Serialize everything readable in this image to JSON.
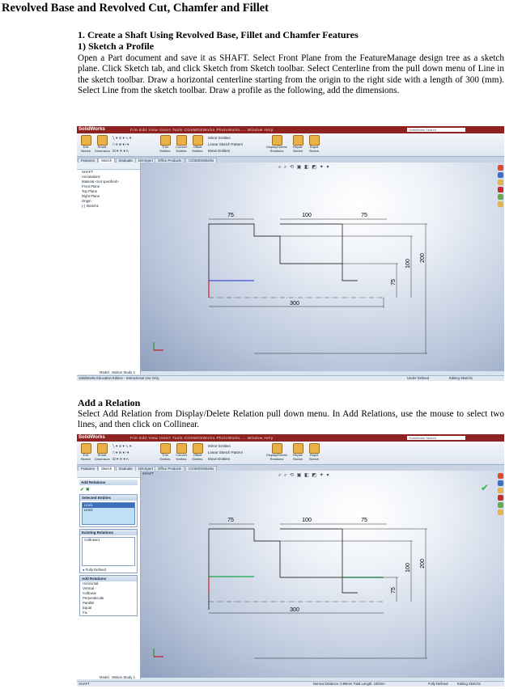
{
  "document": {
    "title": "Revolved Base and Revolved Cut, Chamfer and Fillet",
    "heading1": "1. Create a Shaft Using Revolved Base, Fillet and Chamfer Features",
    "heading2": "1) Sketch a Profile",
    "paragraph1": "Open a Part document and save it as SHAFT. Select Front Plane from the FeatureManage design tree as a sketch plane. Click Sketch tab, and click Sketch from Sketch toolbar. Select Centerline from the pull down menu of Line in the sketch toolbar. Draw a horizontal centerline starting from the origin to the right side with a length of 300 (mm). Select Line from the sketch toolbar. Draw a profile as the following, add the dimensions.",
    "heading3": "Add a Relation",
    "paragraph2": "Select Add Relation from Display/Delete Relation pull down menu. In Add Relations, use the mouse to select two lines, and then click on Collinear."
  },
  "app": {
    "logo": "SolidWorks",
    "menu": "File   Edit   View   Insert   Tools   COSMOSWorks   PhotoWorks   ...   Window   Help",
    "search_placeholder": "SolidWorks Search",
    "ribbon": {
      "exit_sketch": "Exit Sketch",
      "smart_dimension": "Smart Dimension",
      "trim_entities": "Trim Entities",
      "convert_entities": "Convert Entities",
      "offset_entities": "Offset Entities",
      "mirror_entities": "Mirror Entities",
      "linear_pattern": "Linear Sketch Pattern",
      "move_entities": "Move Entities",
      "display_delete_relations": "Display/Delete Relations",
      "repair_sketch": "Repair Sketch",
      "rapid_sketch": "Rapid Sketch"
    },
    "tabs": [
      "Features",
      "Sketch",
      "Evaluate",
      "DimXpert",
      "Office Products",
      "COSMOSWorks",
      "..."
    ],
    "bottom_tabs": [
      "Model",
      "Motion Study 1"
    ],
    "tree": [
      "SHAFT",
      "Annotations",
      "Material <not specified>",
      "Front Plane",
      "Top Plane",
      "Right Plane",
      "Origin",
      "(-) Sketch1"
    ]
  },
  "screenshot1": {
    "status_left": "SolidWorks Education Edition - Instructional Use Only",
    "status_under": "Under Defined",
    "status_editing": "Editing Sketch1"
  },
  "screenshot2": {
    "panel_title": "Add Relations",
    "selected_entities_header": "Selected Entities",
    "selected_entities": [
      "Line1",
      "Line3"
    ],
    "existing_relations_header": "Existing Relations",
    "existing_relations": [
      "Collinear1"
    ],
    "fully_defined": "Fully Defined",
    "add_relations_header": "Add Relations",
    "add_relations": [
      "Horizontal",
      "Vertical",
      "Collinear",
      "Perpendicular",
      "Parallel",
      "Equal",
      "Fix"
    ],
    "tree_root": "SHAFT",
    "status_left": "SHAFT",
    "status_measure": "Normal Distance: 0.99mm  Total Length: 150mm",
    "status_defined": "Fully Defined",
    "status_editing": "Editing Sketch1"
  },
  "dimensions": {
    "d75_top": "75",
    "d100_top": "100",
    "d75_right": "75",
    "d100_v": "100",
    "d200_v": "200",
    "d75_v": "75",
    "d300": "300"
  },
  "colors": {
    "titlebar": "#8d2221",
    "under_defined_line": "#1a2bd6",
    "collinear_line": "#11a84a",
    "origin": "#cc0000"
  }
}
